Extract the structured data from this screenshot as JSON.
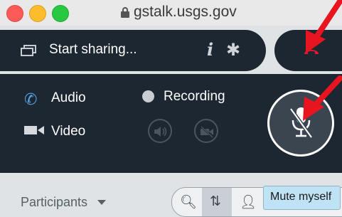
{
  "browser": {
    "url": "gstalk.usgs.gov"
  },
  "share": {
    "label": "Start sharing...",
    "info_icon": "i"
  },
  "media": {
    "audio_label": "Audio",
    "video_label": "Video",
    "recording_label": "Recording"
  },
  "participants": {
    "label": "Participants"
  },
  "tooltip": {
    "text": "Mute myself"
  },
  "colors": {
    "bar_bg": "#1d2731",
    "accent_blue": "#4fa7e8",
    "hangup_red": "#e2172c",
    "arrow_red": "#e8141f"
  }
}
